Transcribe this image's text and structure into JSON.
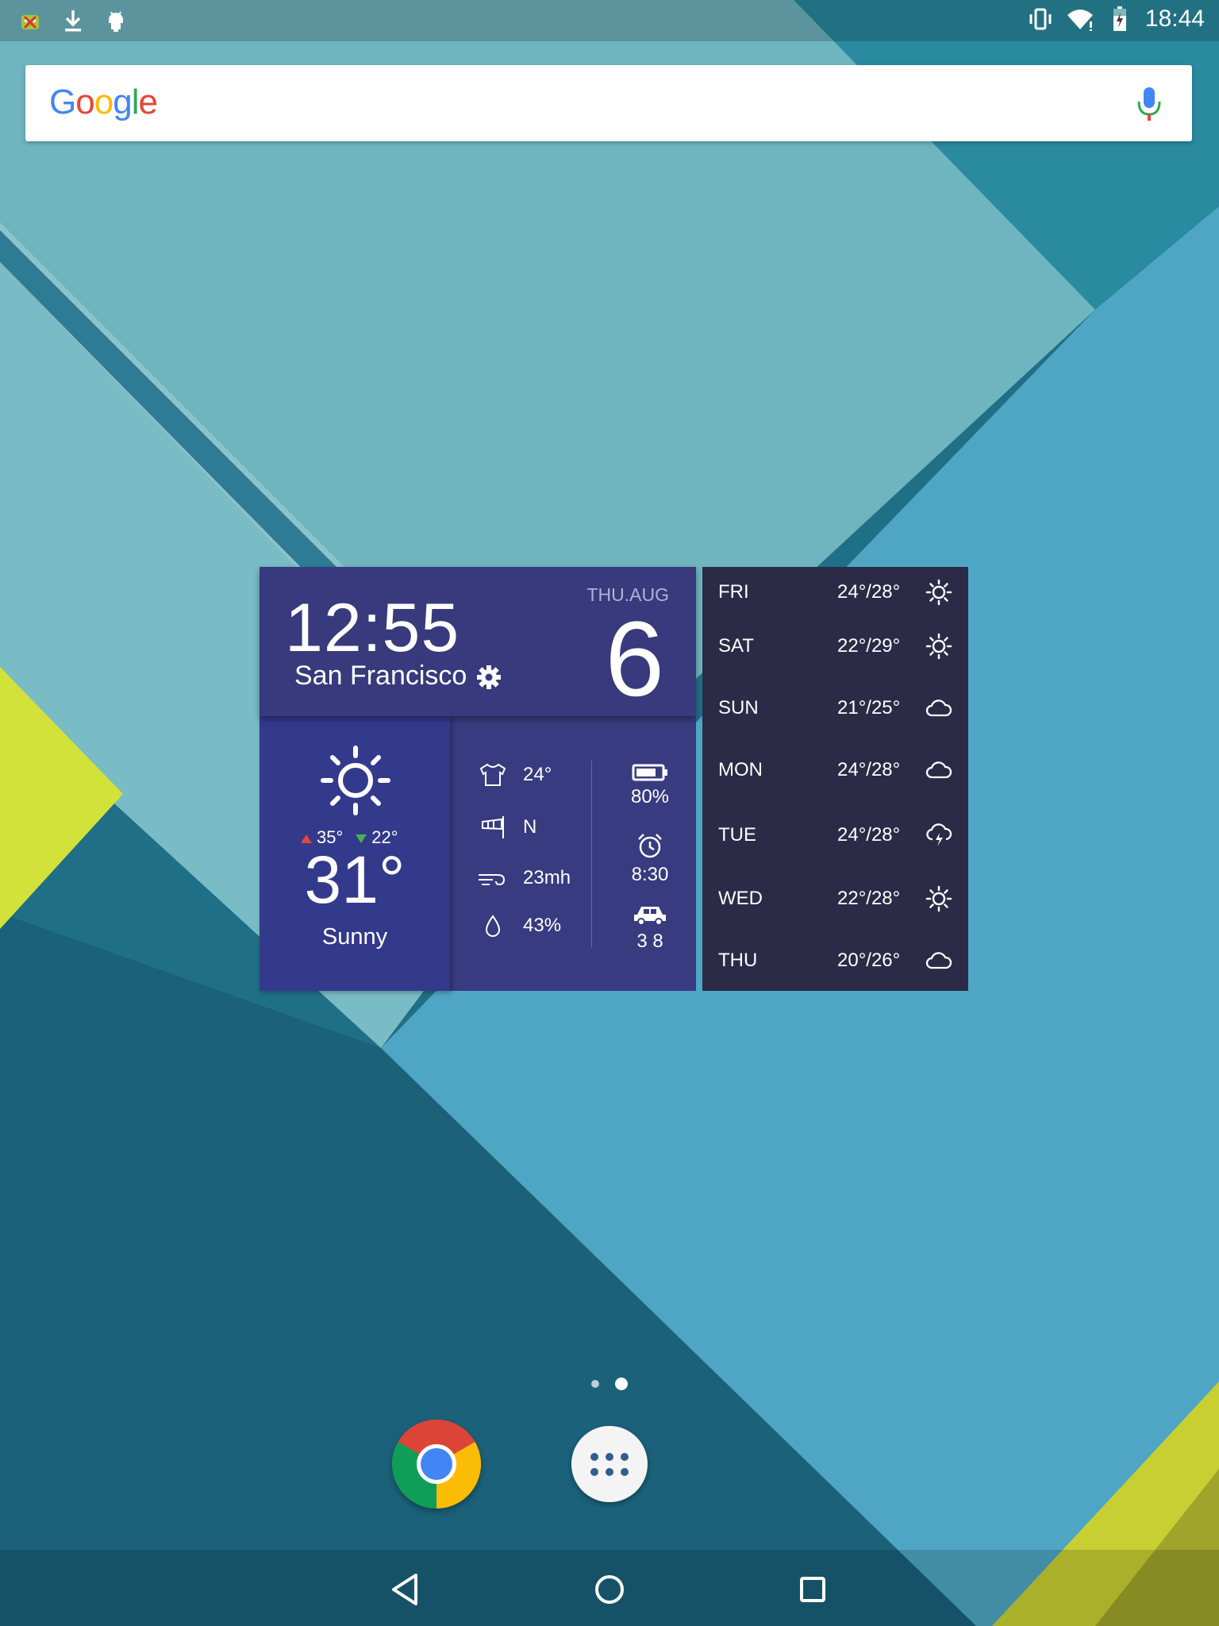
{
  "status_bar": {
    "time": "18:44",
    "left_icons": [
      "android-debug-icon",
      "download-icon",
      "android-icon"
    ],
    "right_icons": [
      "vibrate-icon",
      "wifi-icon",
      "battery-icon"
    ]
  },
  "search": {
    "logo_letters": [
      "G",
      "o",
      "o",
      "g",
      "l",
      "e"
    ],
    "logo_colors": [
      "#4285F4",
      "#EA4335",
      "#FBBC05",
      "#4285F4",
      "#34A853",
      "#EA4335"
    ],
    "mic_icon": "mic-icon"
  },
  "weather": {
    "clock": "12:55",
    "city": "San Francisco",
    "date_label": "THU.AUG",
    "day_number": "6",
    "current": {
      "icon": "sun-icon",
      "high": "35°",
      "low": "22°",
      "temp": "31°",
      "condition": "Sunny"
    },
    "details": {
      "feels_like": "24°",
      "wind_direction": "N",
      "wind_speed": "23mh",
      "humidity": "43%"
    },
    "stats": {
      "battery": "80%",
      "battery_level": 0.8,
      "alarm": "8:30",
      "traffic": "3 8"
    },
    "forecast": [
      {
        "day": "FRI",
        "temp": "24°/28°",
        "icon": "sun-icon"
      },
      {
        "day": "SAT",
        "temp": "22°/29°",
        "icon": "sun-icon"
      },
      {
        "day": "SUN",
        "temp": "21°/25°",
        "icon": "cloud-icon"
      },
      {
        "day": "MON",
        "temp": "24°/28°",
        "icon": "cloud-icon"
      },
      {
        "day": "TUE",
        "temp": "24°/28°",
        "icon": "storm-icon"
      },
      {
        "day": "WED",
        "temp": "22°/28°",
        "icon": "sun-icon"
      },
      {
        "day": "THU",
        "temp": "20°/26°",
        "icon": "cloud-icon"
      }
    ]
  },
  "home": {
    "pages": 2,
    "current_page": 2,
    "dock": [
      "chrome-icon",
      "app-drawer-icon"
    ]
  },
  "nav": [
    "back-icon",
    "home-icon",
    "recents-icon"
  ]
}
